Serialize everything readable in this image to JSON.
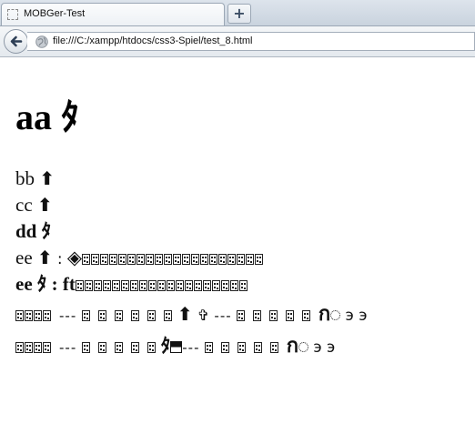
{
  "browser": {
    "tab_title": "MOBGer-Test",
    "new_tab_symbol": "+",
    "url": "file:///C:/xampp/htdocs/css3-Spiel/test_8.html",
    "icons": [
      "blank-page-icon",
      "plus-icon",
      "back-arrow-icon",
      "globe-icon"
    ]
  },
  "page": {
    "heading": {
      "text": "aa",
      "glyph": "ﾀ"
    },
    "lines": [
      {
        "text": "bb",
        "glyph": "⬆"
      },
      {
        "text": "cc",
        "glyph": "⬆"
      },
      {
        "text": "dd",
        "glyph": "ﾀ"
      },
      {
        "text": "ee",
        "glyph": "⬆",
        "sep": ":",
        "symbol": "◈"
      },
      {
        "text": "ee",
        "glyph": "ﾀ",
        "sep": ":",
        "symbol": "ft"
      }
    ],
    "row6": {
      "dash1": "---",
      "arrow": "⬆",
      "cross": "✞",
      "dash2": "---",
      "letter": "ก",
      "tail": "э э"
    },
    "row7": {
      "dash1": "---",
      "glyph": "ﾀ",
      "dash2": "---",
      "letter": "ก",
      "tail": "э э"
    }
  }
}
